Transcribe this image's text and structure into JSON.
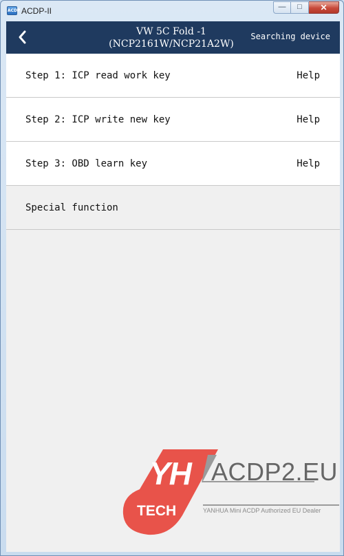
{
  "window": {
    "title": "ACDP-II",
    "icon_text": "ACDP",
    "controls": {
      "minimize": "—",
      "maximize": "□",
      "close": "✕"
    }
  },
  "header": {
    "title_line1": "VW 5C Fold -1",
    "title_line2": "(NCP2161W/NCP21A2W)",
    "status": "Searching device",
    "back_icon": "chevron-left-icon",
    "background": "#1f3a5f"
  },
  "menu": {
    "items": [
      {
        "label": "Step 1: ICP read work key",
        "help": "Help"
      },
      {
        "label": "Step 2: ICP write new key",
        "help": "Help"
      },
      {
        "label": "Step 3: OBD learn key",
        "help": "Help"
      },
      {
        "label": "Special function"
      }
    ]
  },
  "watermark": {
    "logo_mark": "YH",
    "logo_tech": "TECH",
    "site": "ACDP2.EU",
    "tagline": "YANHUA Mini ACDP Authorized EU Dealer",
    "logo_color": "#e8534a"
  }
}
